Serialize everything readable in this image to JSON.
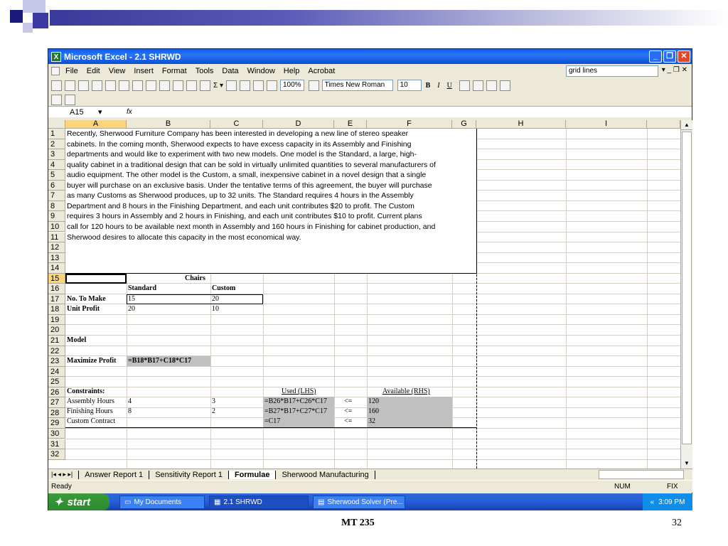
{
  "window": {
    "title": "Microsoft Excel - 2.1 SHRWD"
  },
  "menu": {
    "items": [
      "File",
      "Edit",
      "View",
      "Insert",
      "Format",
      "Tools",
      "Data",
      "Window",
      "Help",
      "Acrobat"
    ],
    "help_box": "grid lines"
  },
  "toolbar": {
    "zoom": "100%",
    "font": "Times New Roman",
    "size": "10",
    "bold": "B",
    "italic": "I",
    "underline": "U"
  },
  "formula_bar": {
    "name_box": "A15",
    "fx": "fx"
  },
  "columns": [
    "A",
    "B",
    "C",
    "D",
    "E",
    "F",
    "G",
    "H",
    "I"
  ],
  "rows": [
    "1",
    "2",
    "3",
    "4",
    "5",
    "6",
    "7",
    "8",
    "9",
    "10",
    "11",
    "12",
    "13",
    "14",
    "15",
    "16",
    "17",
    "18",
    "19",
    "20",
    "21",
    "22",
    "23",
    "24",
    "25",
    "26",
    "27",
    "28",
    "29",
    "30",
    "31",
    "32"
  ],
  "paragraph": [
    "Recently, Sherwood Furniture Company has been interested in developing a new line of stereo speaker",
    "cabinets.  In the coming month, Sherwood expects to have excess capacity in its Assembly and Finishing",
    "departments and would like to experiment with two new models.  One model is the Standard, a large, high-",
    "quality cabinet in a traditional design that can be sold in virtually unlimited quantities to several manufacturers of",
    "audio equipment.  The other model is the Custom, a small, inexpensive cabinet in a novel design that a single",
    "buyer will purchase on an exclusive basis.  Under the tentative terms of this agreement, the buyer will purchase",
    "as many Customs as Sherwood produces, up to 32 units.  The Standard requires 4 hours in the Assembly",
    "Department and 8 hours in the Finishing Department, and each unit contributes $20 to profit.  The Custom",
    "requires 3 hours in Assembly and 2 hours in Finishing, and each unit contributes $10 to profit.  Current plans",
    "call for 120 hours to be available next month in Assembly and 160 hours in Finishing for cabinet production, and",
    "Sherwood desires to allocate this capacity in the most economical way."
  ],
  "model": {
    "chairs": "Chairs",
    "standard": "Standard",
    "custom": "Custom",
    "no_to_make": "No. To Make",
    "make_std": "15",
    "make_cus": "20",
    "unit_profit": "Unit Profit",
    "profit_std": "20",
    "profit_cus": "10",
    "model_label": "Model",
    "max_profit": "Maximize Profit",
    "max_formula": "=B18*B17+C18*C17",
    "constraints": "Constraints:",
    "used": "Used (LHS)",
    "available": "Available (RHS)",
    "c1_name": "Assembly Hours",
    "c1_std": "4",
    "c1_cus": "3",
    "c1_used": "=B26*B17+C26*C17",
    "c1_op": "<=",
    "c1_avail": "120",
    "c2_name": "Finishing Hours",
    "c2_std": "8",
    "c2_cus": "2",
    "c2_used": "=B27*B17+C27*C17",
    "c2_op": "<=",
    "c2_avail": "160",
    "c3_name": "Custom Contract",
    "c3_used": "=C17",
    "c3_op": "<=",
    "c3_avail": "32"
  },
  "sheet_tabs": [
    "Answer Report 1",
    "Sensitivity Report 1",
    "Formulae",
    "Sherwood Manufacturing"
  ],
  "status": {
    "left": "Ready",
    "num": "NUM",
    "fix": "FIX"
  },
  "taskbar": {
    "start": "start",
    "tasks": [
      "My Documents",
      "2.1 SHRWD",
      "Sherwood Solver (Pre..."
    ],
    "time": "3:09 PM"
  },
  "footer": {
    "title": "MT 235",
    "page": "32"
  }
}
